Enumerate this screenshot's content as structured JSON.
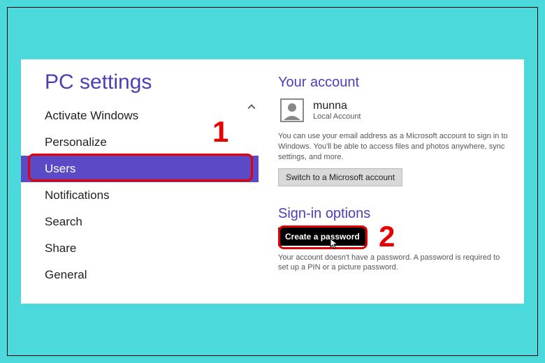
{
  "title": "PC settings",
  "nav": {
    "activate": "Activate Windows",
    "personalize": "Personalize",
    "users": "Users",
    "notifications": "Notifications",
    "search": "Search",
    "share": "Share",
    "general": "General"
  },
  "account": {
    "section_title": "Your account",
    "name": "munna",
    "type": "Local Account",
    "description": "You can use your email address as a Microsoft account to sign in to Windows. You'll be able to access files and photos anywhere, sync settings, and more.",
    "switch_button": "Switch to a Microsoft account"
  },
  "signin": {
    "section_title": "Sign-in options",
    "create_button": "Create a password",
    "description": "Your account doesn't have a password. A password is required to set up a PIN or a picture password."
  },
  "annotations": {
    "num1": "1",
    "num2": "2"
  },
  "colors": {
    "page_bg": "#4bd9dc",
    "accent": "#5b4ac5",
    "heading": "#4b3fb8",
    "annotation": "#e60000"
  }
}
